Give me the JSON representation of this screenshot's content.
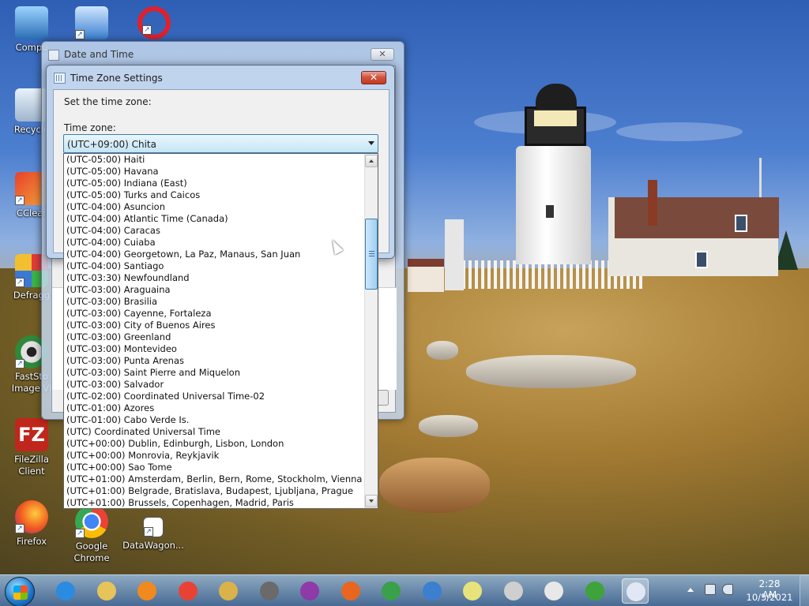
{
  "desktop": {
    "icons": [
      {
        "label": "Compu",
        "icon": "computer-icon"
      },
      {
        "label": "Recycle",
        "icon": "recycle-bin-icon"
      },
      {
        "label": "CClear",
        "icon": "ccleaner-icon"
      },
      {
        "label": "Defragg",
        "icon": "defraggler-icon"
      },
      {
        "label": "FastSto",
        "label2": "Image Vi",
        "icon": "faststone-icon"
      },
      {
        "label": "FileZilla Client",
        "icon": "filezilla-icon"
      },
      {
        "label": "Firefox",
        "icon": "firefox-icon"
      },
      {
        "label": "Google",
        "label2": "Chrome",
        "icon": "chrome-icon"
      },
      {
        "label": "DataWagon...",
        "icon": "datawagon-icon"
      }
    ]
  },
  "date_time_window": {
    "title": "Date and Time",
    "close_symbol": "✕"
  },
  "tz_dialog": {
    "title": "Time Zone Settings",
    "close_symbol": "✕",
    "heading": "Set the time zone:",
    "timezone_label": "Time zone:",
    "selected": "(UTC+09:00) Chita",
    "options": [
      "(UTC-05:00) Haiti",
      "(UTC-05:00) Havana",
      "(UTC-05:00) Indiana (East)",
      "(UTC-05:00) Turks and Caicos",
      "(UTC-04:00) Asuncion",
      "(UTC-04:00) Atlantic Time (Canada)",
      "(UTC-04:00) Caracas",
      "(UTC-04:00) Cuiaba",
      "(UTC-04:00) Georgetown, La Paz, Manaus, San Juan",
      "(UTC-04:00) Santiago",
      "(UTC-03:30) Newfoundland",
      "(UTC-03:00) Araguaina",
      "(UTC-03:00) Brasilia",
      "(UTC-03:00) Cayenne, Fortaleza",
      "(UTC-03:00) City of Buenos Aires",
      "(UTC-03:00) Greenland",
      "(UTC-03:00) Montevideo",
      "(UTC-03:00) Punta Arenas",
      "(UTC-03:00) Saint Pierre and Miquelon",
      "(UTC-03:00) Salvador",
      "(UTC-02:00) Coordinated Universal Time-02",
      "(UTC-01:00) Azores",
      "(UTC-01:00) Cabo Verde Is.",
      "(UTC) Coordinated Universal Time",
      "(UTC+00:00) Dublin, Edinburgh, Lisbon, London",
      "(UTC+00:00) Monrovia, Reykjavik",
      "(UTC+00:00) Sao Tome",
      "(UTC+01:00) Amsterdam, Berlin, Bern, Rome, Stockholm, Vienna",
      "(UTC+01:00) Belgrade, Bratislava, Budapest, Ljubljana, Prague",
      "(UTC+01:00) Brussels, Copenhagen, Madrid, Paris"
    ]
  },
  "taskbar": {
    "apps": [
      {
        "icon": "internet-explorer-icon",
        "color": "#2b8be0"
      },
      {
        "icon": "file-explorer-icon",
        "color": "#e6c45a"
      },
      {
        "icon": "media-player-icon",
        "color": "#f08a1e"
      },
      {
        "icon": "chrome-icon",
        "color": "#e94235"
      },
      {
        "icon": "settings-tool-icon",
        "color": "#d9b34a"
      },
      {
        "icon": "ccleaner-icon",
        "color": "#6a6a6a"
      },
      {
        "icon": "winrar-icon",
        "color": "#8e3aa8"
      },
      {
        "icon": "firefox-icon",
        "color": "#e8661f"
      },
      {
        "icon": "shield-app-icon",
        "color": "#3aa04a"
      },
      {
        "icon": "qbittorrent-icon",
        "color": "#3b7fd0"
      },
      {
        "icon": "sticky-notes-icon",
        "color": "#e8e27a"
      },
      {
        "icon": "disc-icon",
        "color": "#cfcfcf"
      },
      {
        "icon": "sphere-icon",
        "color": "#e8e8e8"
      },
      {
        "icon": "windows-update-icon",
        "color": "#3ea33a"
      },
      {
        "icon": "date-time-icon",
        "color": "#dfe8f4"
      }
    ],
    "clock_time": "2:28 AM",
    "clock_date": "10/5/2021"
  }
}
